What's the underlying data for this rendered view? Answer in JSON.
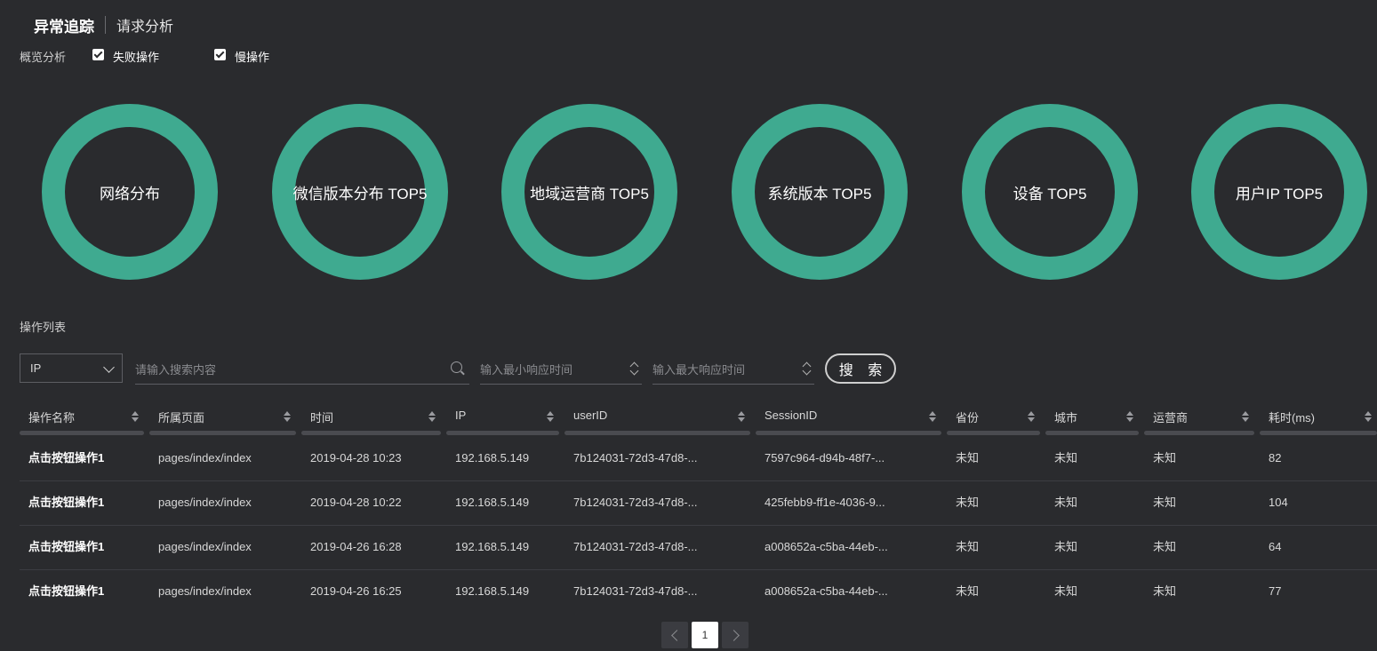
{
  "tabs": {
    "active": "异常追踪",
    "other": "请求分析"
  },
  "overview": {
    "label": "概览分析",
    "checkboxes": [
      {
        "label": "失败操作",
        "checked": true
      },
      {
        "label": "慢操作",
        "checked": true
      }
    ]
  },
  "donuts": [
    "网络分布",
    "微信版本分布 TOP5",
    "地域运营商 TOP5",
    "系统版本 TOP5",
    "设备 TOP5",
    "用户IP TOP5"
  ],
  "colors": {
    "donut": "#3faa90",
    "background": "#2a2b2e"
  },
  "list": {
    "title": "操作列表",
    "filter_select": "IP",
    "search_placeholder": "请输入搜索内容",
    "min_placeholder": "输入最小响应时间",
    "max_placeholder": "输入最大响应时间",
    "search_button": "搜 索",
    "columns": [
      "操作名称",
      "所属页面",
      "时间",
      "IP",
      "userID",
      "SessionID",
      "省份",
      "城市",
      "运营商",
      "耗时(ms)"
    ],
    "rows": [
      [
        "点击按钮操作1",
        "pages/index/index",
        "2019-04-28 10:23",
        "192.168.5.149",
        "7b124031-72d3-47d8-...",
        "7597c964-d94b-48f7-...",
        "未知",
        "未知",
        "未知",
        "82"
      ],
      [
        "点击按钮操作1",
        "pages/index/index",
        "2019-04-28 10:22",
        "192.168.5.149",
        "7b124031-72d3-47d8-...",
        "425febb9-ff1e-4036-9...",
        "未知",
        "未知",
        "未知",
        "104"
      ],
      [
        "点击按钮操作1",
        "pages/index/index",
        "2019-04-26 16:28",
        "192.168.5.149",
        "7b124031-72d3-47d8-...",
        "a008652a-c5ba-44eb-...",
        "未知",
        "未知",
        "未知",
        "64"
      ],
      [
        "点击按钮操作1",
        "pages/index/index",
        "2019-04-26 16:25",
        "192.168.5.149",
        "7b124031-72d3-47d8-...",
        "a008652a-c5ba-44eb-...",
        "未知",
        "未知",
        "未知",
        "77"
      ]
    ]
  },
  "pagination": {
    "current": "1"
  }
}
